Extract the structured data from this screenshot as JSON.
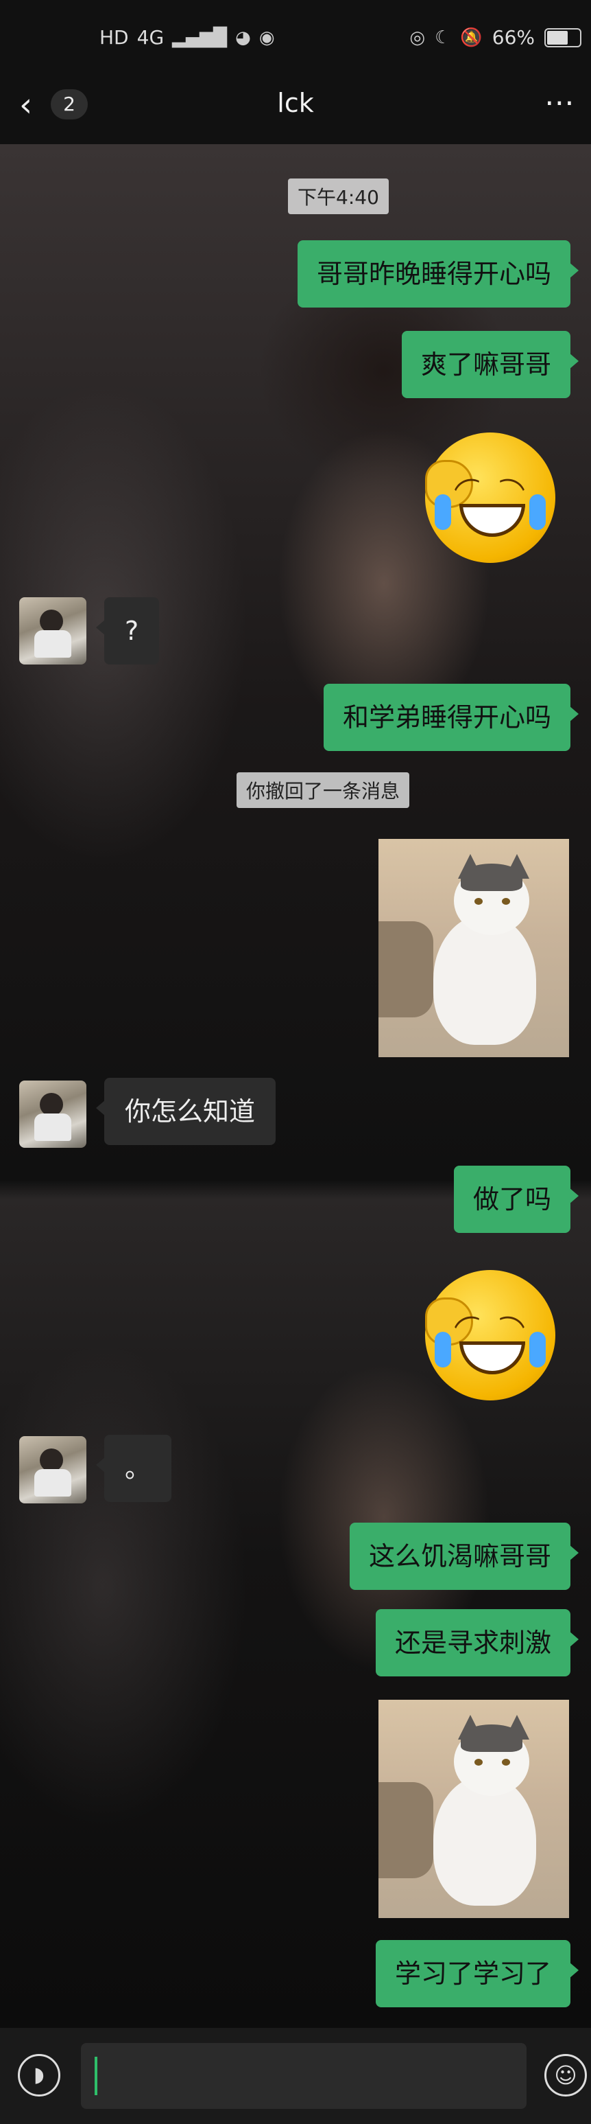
{
  "status_bar": {
    "left_labels": [
      "HD",
      "4G",
      "1₁."
    ],
    "battery_text": "66%",
    "battery_level": 0.66
  },
  "nav": {
    "back_icon": "chevron-left-icon",
    "unread_count": "2",
    "title": "lck",
    "more_icon": "ellipsis-icon"
  },
  "messages": {
    "timestamp": "下午4:40",
    "m1": "哥哥昨晚睡得开心吗",
    "m2": "爽了嘛哥哥",
    "m3_sticker": "laughing-crying-emoji",
    "m4_in": "?",
    "m5": "和学弟睡得开心吗",
    "recalled_notice": "你撤回了一条消息",
    "m6_image": "cat-photo",
    "m7_in": "你怎么知道",
    "m8": "做了吗",
    "m9_sticker": "laughing-crying-emoji",
    "m10_in": "。",
    "m11": "这么饥渴嘛哥哥",
    "m12": "还是寻求刺激",
    "m13_image": "cat-photo",
    "m14": "学习了学习了"
  },
  "colors": {
    "outgoing_bubble": "#3aae6a",
    "incoming_bubble": "#2c2c2c",
    "caret": "#2fbf6a"
  },
  "input_bar": {
    "voice_icon": "voice-icon",
    "emoji_icon": "emoji-icon",
    "text_value": ""
  }
}
